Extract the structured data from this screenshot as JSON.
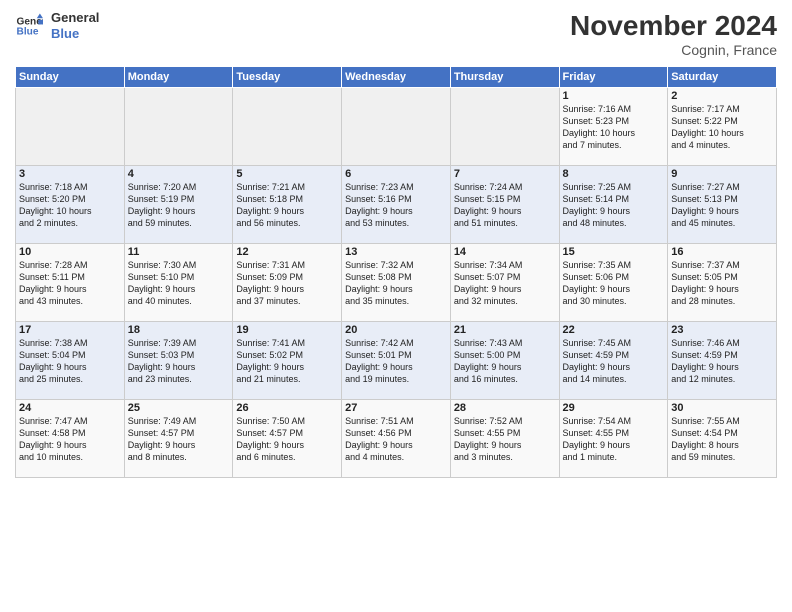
{
  "logo": {
    "line1": "General",
    "line2": "Blue"
  },
  "title": "November 2024",
  "location": "Cognin, France",
  "weekdays": [
    "Sunday",
    "Monday",
    "Tuesday",
    "Wednesday",
    "Thursday",
    "Friday",
    "Saturday"
  ],
  "weeks": [
    [
      {
        "day": "",
        "info": ""
      },
      {
        "day": "",
        "info": ""
      },
      {
        "day": "",
        "info": ""
      },
      {
        "day": "",
        "info": ""
      },
      {
        "day": "",
        "info": ""
      },
      {
        "day": "1",
        "info": "Sunrise: 7:16 AM\nSunset: 5:23 PM\nDaylight: 10 hours\nand 7 minutes."
      },
      {
        "day": "2",
        "info": "Sunrise: 7:17 AM\nSunset: 5:22 PM\nDaylight: 10 hours\nand 4 minutes."
      }
    ],
    [
      {
        "day": "3",
        "info": "Sunrise: 7:18 AM\nSunset: 5:20 PM\nDaylight: 10 hours\nand 2 minutes."
      },
      {
        "day": "4",
        "info": "Sunrise: 7:20 AM\nSunset: 5:19 PM\nDaylight: 9 hours\nand 59 minutes."
      },
      {
        "day": "5",
        "info": "Sunrise: 7:21 AM\nSunset: 5:18 PM\nDaylight: 9 hours\nand 56 minutes."
      },
      {
        "day": "6",
        "info": "Sunrise: 7:23 AM\nSunset: 5:16 PM\nDaylight: 9 hours\nand 53 minutes."
      },
      {
        "day": "7",
        "info": "Sunrise: 7:24 AM\nSunset: 5:15 PM\nDaylight: 9 hours\nand 51 minutes."
      },
      {
        "day": "8",
        "info": "Sunrise: 7:25 AM\nSunset: 5:14 PM\nDaylight: 9 hours\nand 48 minutes."
      },
      {
        "day": "9",
        "info": "Sunrise: 7:27 AM\nSunset: 5:13 PM\nDaylight: 9 hours\nand 45 minutes."
      }
    ],
    [
      {
        "day": "10",
        "info": "Sunrise: 7:28 AM\nSunset: 5:11 PM\nDaylight: 9 hours\nand 43 minutes."
      },
      {
        "day": "11",
        "info": "Sunrise: 7:30 AM\nSunset: 5:10 PM\nDaylight: 9 hours\nand 40 minutes."
      },
      {
        "day": "12",
        "info": "Sunrise: 7:31 AM\nSunset: 5:09 PM\nDaylight: 9 hours\nand 37 minutes."
      },
      {
        "day": "13",
        "info": "Sunrise: 7:32 AM\nSunset: 5:08 PM\nDaylight: 9 hours\nand 35 minutes."
      },
      {
        "day": "14",
        "info": "Sunrise: 7:34 AM\nSunset: 5:07 PM\nDaylight: 9 hours\nand 32 minutes."
      },
      {
        "day": "15",
        "info": "Sunrise: 7:35 AM\nSunset: 5:06 PM\nDaylight: 9 hours\nand 30 minutes."
      },
      {
        "day": "16",
        "info": "Sunrise: 7:37 AM\nSunset: 5:05 PM\nDaylight: 9 hours\nand 28 minutes."
      }
    ],
    [
      {
        "day": "17",
        "info": "Sunrise: 7:38 AM\nSunset: 5:04 PM\nDaylight: 9 hours\nand 25 minutes."
      },
      {
        "day": "18",
        "info": "Sunrise: 7:39 AM\nSunset: 5:03 PM\nDaylight: 9 hours\nand 23 minutes."
      },
      {
        "day": "19",
        "info": "Sunrise: 7:41 AM\nSunset: 5:02 PM\nDaylight: 9 hours\nand 21 minutes."
      },
      {
        "day": "20",
        "info": "Sunrise: 7:42 AM\nSunset: 5:01 PM\nDaylight: 9 hours\nand 19 minutes."
      },
      {
        "day": "21",
        "info": "Sunrise: 7:43 AM\nSunset: 5:00 PM\nDaylight: 9 hours\nand 16 minutes."
      },
      {
        "day": "22",
        "info": "Sunrise: 7:45 AM\nSunset: 4:59 PM\nDaylight: 9 hours\nand 14 minutes."
      },
      {
        "day": "23",
        "info": "Sunrise: 7:46 AM\nSunset: 4:59 PM\nDaylight: 9 hours\nand 12 minutes."
      }
    ],
    [
      {
        "day": "24",
        "info": "Sunrise: 7:47 AM\nSunset: 4:58 PM\nDaylight: 9 hours\nand 10 minutes."
      },
      {
        "day": "25",
        "info": "Sunrise: 7:49 AM\nSunset: 4:57 PM\nDaylight: 9 hours\nand 8 minutes."
      },
      {
        "day": "26",
        "info": "Sunrise: 7:50 AM\nSunset: 4:57 PM\nDaylight: 9 hours\nand 6 minutes."
      },
      {
        "day": "27",
        "info": "Sunrise: 7:51 AM\nSunset: 4:56 PM\nDaylight: 9 hours\nand 4 minutes."
      },
      {
        "day": "28",
        "info": "Sunrise: 7:52 AM\nSunset: 4:55 PM\nDaylight: 9 hours\nand 3 minutes."
      },
      {
        "day": "29",
        "info": "Sunrise: 7:54 AM\nSunset: 4:55 PM\nDaylight: 9 hours\nand 1 minute."
      },
      {
        "day": "30",
        "info": "Sunrise: 7:55 AM\nSunset: 4:54 PM\nDaylight: 8 hours\nand 59 minutes."
      }
    ]
  ]
}
